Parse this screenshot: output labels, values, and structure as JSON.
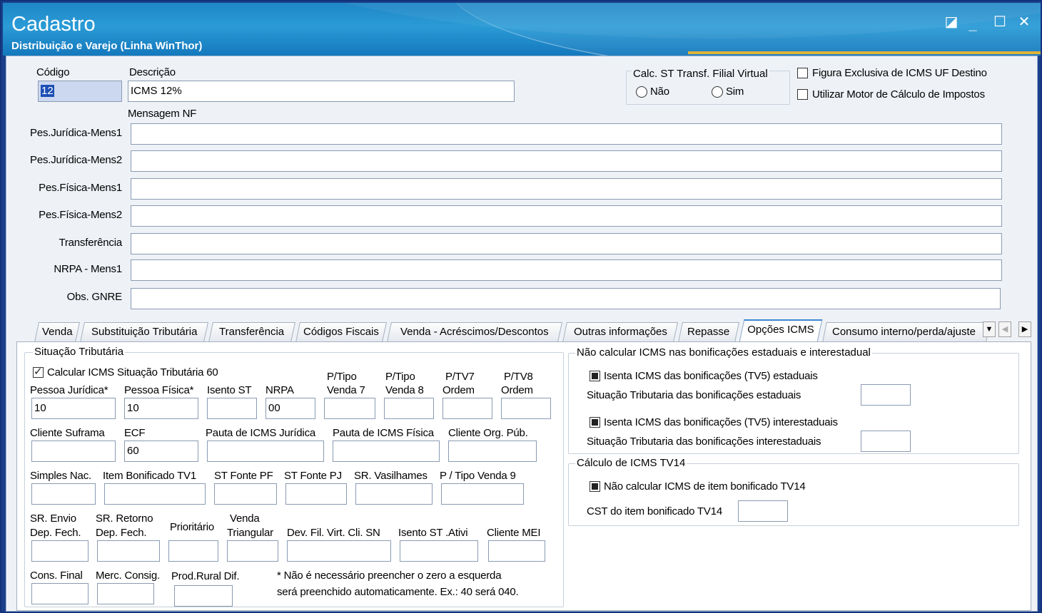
{
  "window": {
    "title": "Cadastro",
    "subtitle": "Distribuição e Varejo (Linha WinThor)"
  },
  "header": {
    "codigo_label": "Código",
    "codigo_value": "12",
    "descricao_label": "Descrição",
    "descricao_value": "ICMS 12%",
    "mensagem_label": "Mensagem NF",
    "calc_st_label": "Calc. ST Transf. Filial Virtual",
    "radio_nao": "Não",
    "radio_sim": "Sim",
    "figura_label": "Figura Exclusiva de ICMS UF Destino",
    "motor_label": "Utilizar Motor de Cálculo de Impostos"
  },
  "messages": [
    {
      "label": "Pes.Jurídica-Mens1",
      "value": ""
    },
    {
      "label": "Pes.Jurídica-Mens2",
      "value": ""
    },
    {
      "label": "Pes.Física-Mens1",
      "value": ""
    },
    {
      "label": "Pes.Física-Mens2",
      "value": ""
    },
    {
      "label": "Transferência",
      "value": ""
    },
    {
      "label": "NRPA - Mens1",
      "value": ""
    },
    {
      "label": "Obs. GNRE",
      "value": ""
    }
  ],
  "tabs": [
    "Venda",
    "Substituição Tributária",
    "Transferência",
    "Códigos Fiscais",
    "Venda - Acréscimos/Descontos",
    "Outras informações",
    "Repasse",
    "Opções ICMS",
    "Consumo interno/perda/ajuste"
  ],
  "active_tab": "Opções ICMS",
  "situacao": {
    "title": "Situação Tributária",
    "calc_st60": "Calcular ICMS Situação Tributária 60",
    "pessoa_juridica": "Pessoa Jurídica*",
    "pessoa_juridica_value": "10",
    "pessoa_fisica": "Pessoa Física*",
    "pessoa_fisica_value": "10",
    "isento_st": "Isento ST",
    "isento_st_value": "",
    "nrpa": "NRPA",
    "nrpa_value": "00",
    "ptv7_1": "P/Tipo",
    "ptv7_2": "Venda 7",
    "ptv8_1": "P/Tipo",
    "ptv8_2": "Venda 8",
    "ptv7o_1": "P/TV7",
    "ptv7o_2": "Ordem",
    "ptv8o_1": "P/TV8",
    "ptv8o_2": "Ordem",
    "cliente_suframa": "Cliente Suframa",
    "ecf": "ECF",
    "ecf_value": "60",
    "pauta_juridica": "Pauta de ICMS Jurídica",
    "pauta_fisica": "Pauta de ICMS Física",
    "cliente_org": "Cliente Org. Púb.",
    "simples": "Simples Nac.",
    "item_bonif": "Item Bonificado TV1",
    "st_fonte_pf": "ST Fonte PF",
    "st_fonte_pj": "ST Fonte PJ",
    "sr_vasilhames": "SR. Vasilhames",
    "ptv9": "P / Tipo Venda 9",
    "sr_envio_1": "SR. Envio",
    "sr_envio_2": "Dep. Fech.",
    "sr_retorno_1": "SR. Retorno",
    "sr_retorno_2": "Dep. Fech.",
    "prioritario": "Prioritário",
    "venda_tri_1": "Venda",
    "venda_tri_2": "Triangular",
    "dev_fil": "Dev. Fil. Virt. Cli. SN",
    "isento_ativ": "Isento ST .Ativi",
    "cliente_mei": "Cliente MEI",
    "cons_final": "Cons. Final",
    "merc_consig": "Merc. Consig.",
    "prod_rural": "Prod.Rural Dif.",
    "note_1": "* Não é necessário preencher o zero a esquerda",
    "note_2": "será preenchido automaticamente.  Ex.: 40 será 040."
  },
  "bonif": {
    "title": "Não calcular ICMS nas bonificações estaduais e interestadual",
    "isenta_est": "Isenta ICMS das bonificações (TV5) estaduais",
    "sit_est": "Situação Tributaria das  bonificações estaduais",
    "isenta_inter": "Isenta ICMS das bonificações (TV5) interestaduais",
    "sit_inter": "Situação Tributaria das  bonificações interestaduais"
  },
  "tv14": {
    "title": "Cálculo de ICMS TV14",
    "nao_calc": "Não calcular ICMS de item bonificado TV14",
    "cst": "CST do item bonificado TV14"
  },
  "colors": {
    "titlebar": "#2a9bd6",
    "accent_line": "#e0b33a",
    "frame": "#1b3f8a"
  }
}
